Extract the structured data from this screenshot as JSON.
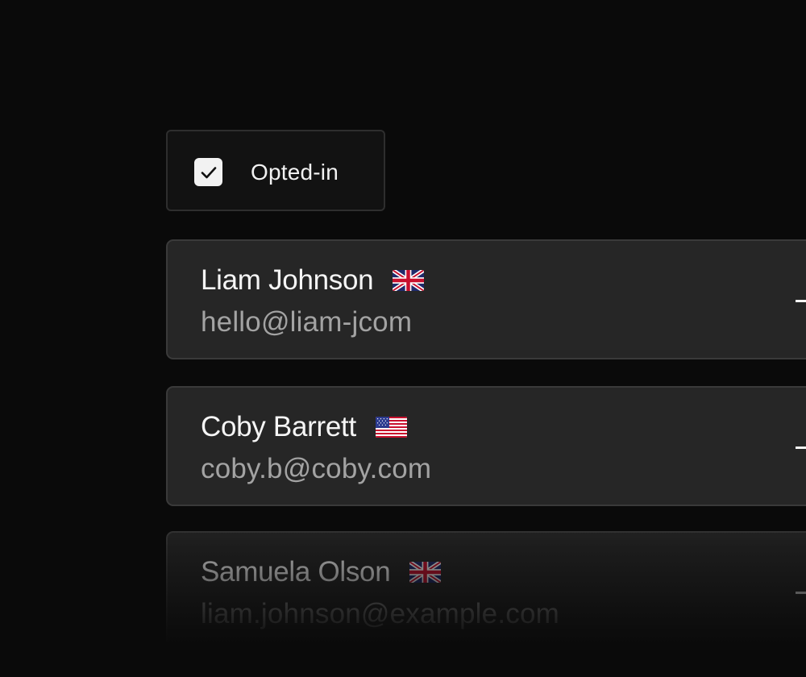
{
  "filter": {
    "label": "Opted-in",
    "checked": true
  },
  "contacts": [
    {
      "name": "Liam Johnson",
      "email": "hello@liam-jcom",
      "flag": "uk-flag-icon"
    },
    {
      "name": "Coby Barrett",
      "email": "coby.b@coby.com",
      "flag": "us-flag-icon"
    },
    {
      "name": "Samuela Olson",
      "email": "liam.johnson@example.com",
      "flag": "uk-flag-icon"
    }
  ],
  "colors": {
    "background": "#0a0a0a",
    "card": "#262626",
    "card_border": "#3a3a3a",
    "text_primary": "#f5f5f5",
    "text_secondary": "#a3a3a3"
  }
}
